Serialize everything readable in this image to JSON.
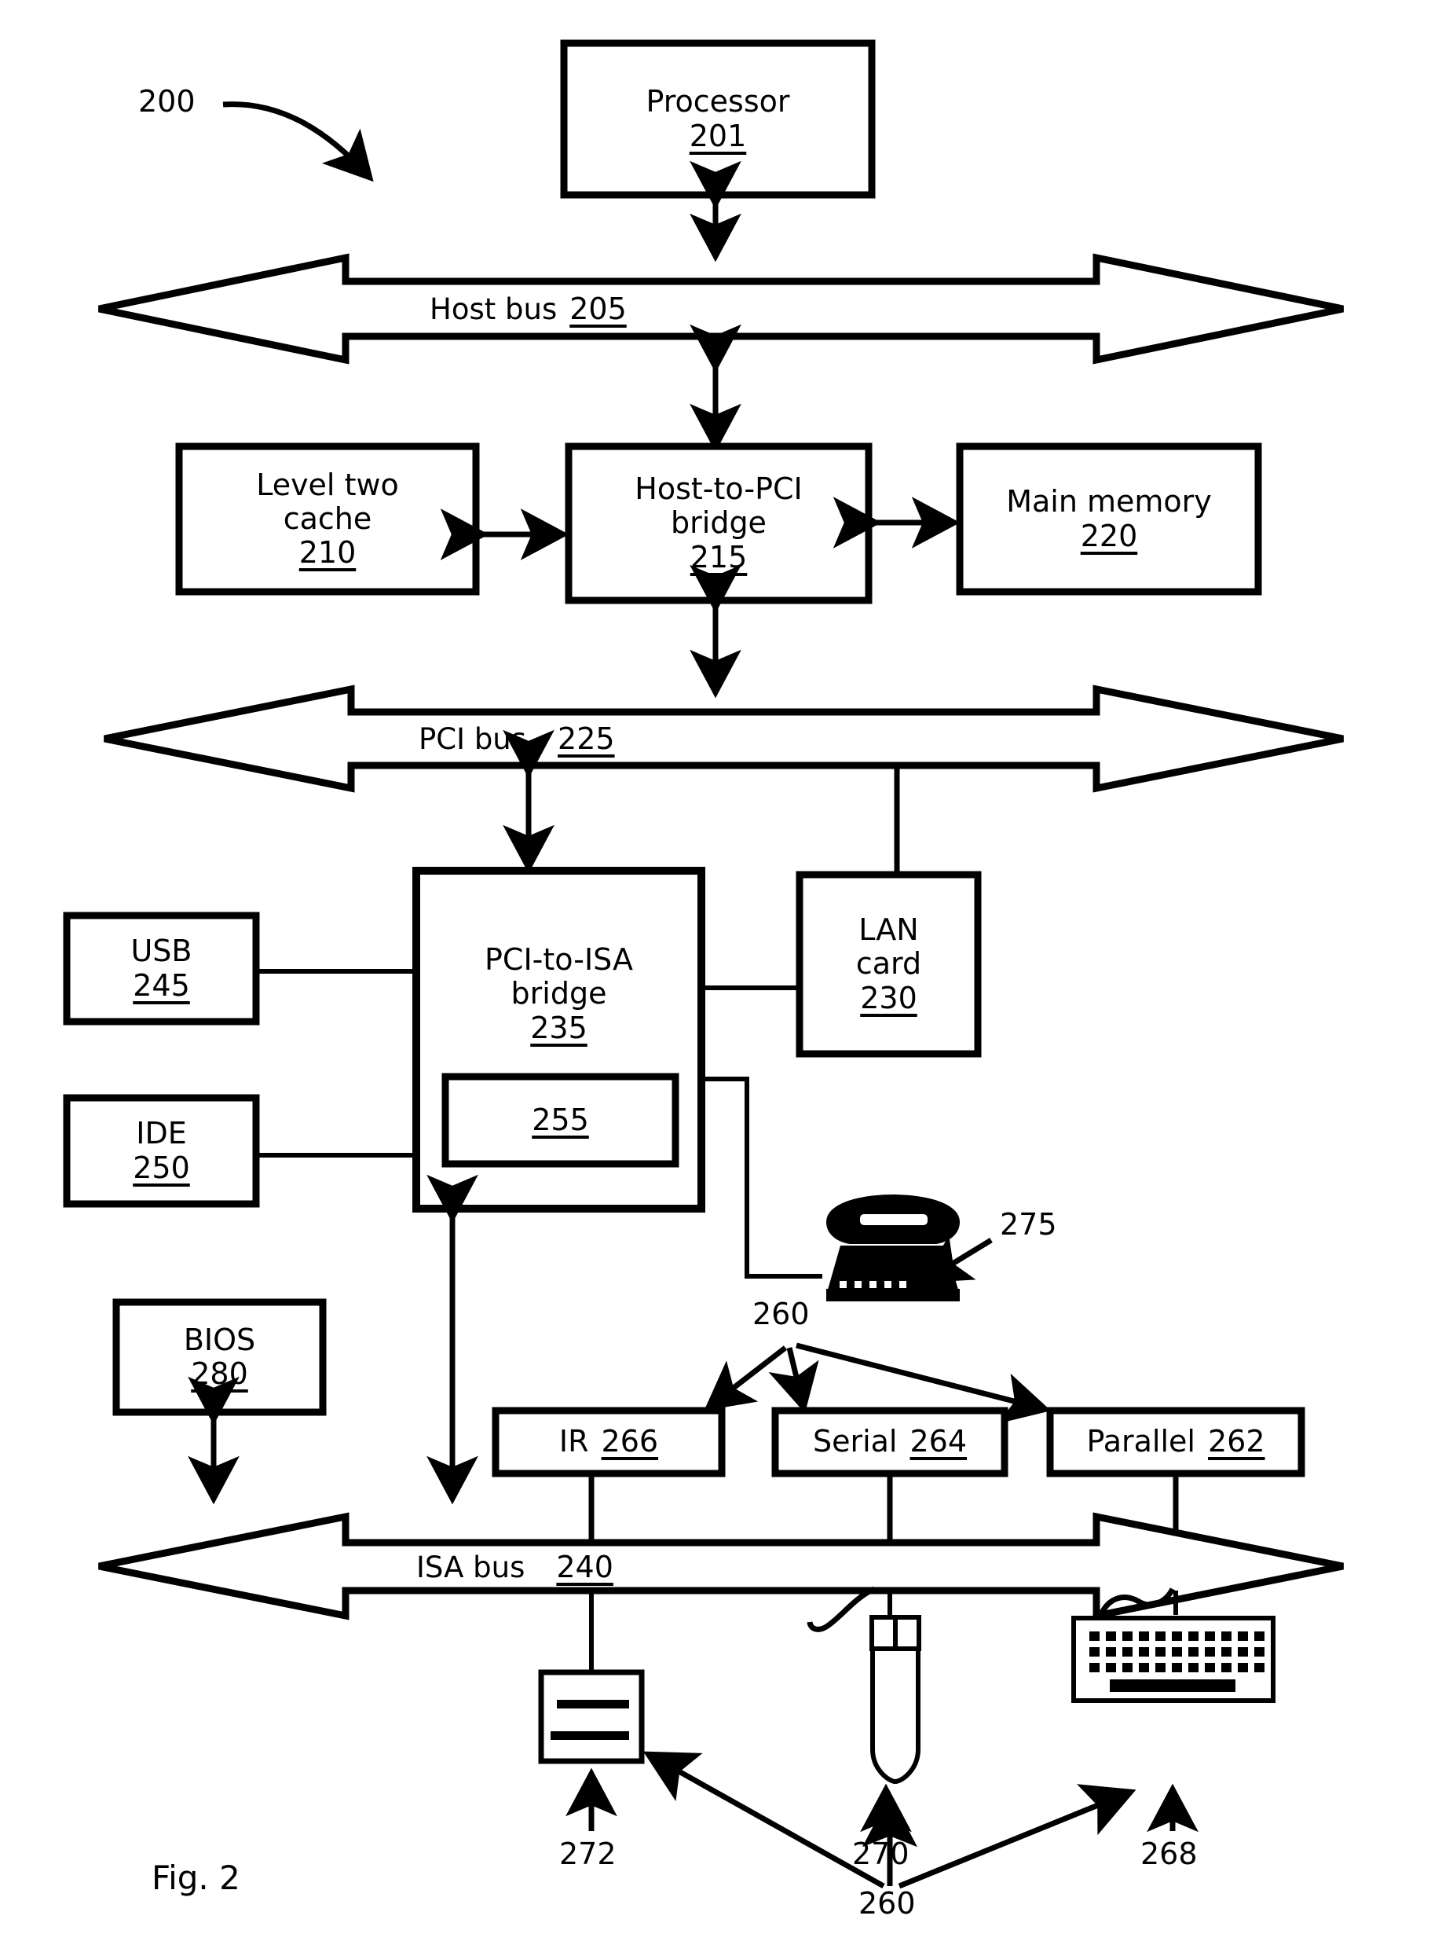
{
  "figure": {
    "caption": "Fig. 2",
    "system_ref": "200"
  },
  "blocks": {
    "processor": {
      "label": "Processor",
      "ref": "201"
    },
    "level_two_cache": {
      "label": "Level two\ncache",
      "ref": "210"
    },
    "host_to_pci_bridge": {
      "label": "Host-to-PCI\nbridge",
      "ref": "215"
    },
    "main_memory": {
      "label": "Main memory",
      "ref": "220"
    },
    "pci_to_isa_bridge": {
      "label": "PCI-to-ISA\nbridge",
      "ref": "235"
    },
    "inner_modem": {
      "label": "",
      "ref": "255"
    },
    "lan_card": {
      "label": "LAN\ncard",
      "ref": "230"
    },
    "usb": {
      "label": "USB",
      "ref": "245"
    },
    "ide": {
      "label": "IDE",
      "ref": "250"
    },
    "bios": {
      "label": "BIOS",
      "ref": "280"
    },
    "ir": {
      "label": "IR",
      "ref": "266"
    },
    "serial": {
      "label": "Serial",
      "ref": "264"
    },
    "parallel": {
      "label": "Parallel",
      "ref": "262"
    }
  },
  "buses": {
    "host_bus": {
      "label": "Host bus",
      "ref": "205"
    },
    "pci_bus": {
      "label": "PCI bus",
      "ref": "225"
    },
    "isa_bus": {
      "label": "ISA bus",
      "ref": "240"
    }
  },
  "callouts": {
    "telephone": "275",
    "ports_group_top": "260",
    "ports_group_bottom": "260",
    "modem_device": "272",
    "mouse": "270",
    "keyboard": "268"
  },
  "icons": {
    "telephone": "telephone-icon",
    "mouse": "mouse-icon",
    "keyboard": "keyboard-icon",
    "modem_device": "modem-device-icon"
  },
  "colors": {
    "stroke": "#000000",
    "fill": "#ffffff"
  }
}
